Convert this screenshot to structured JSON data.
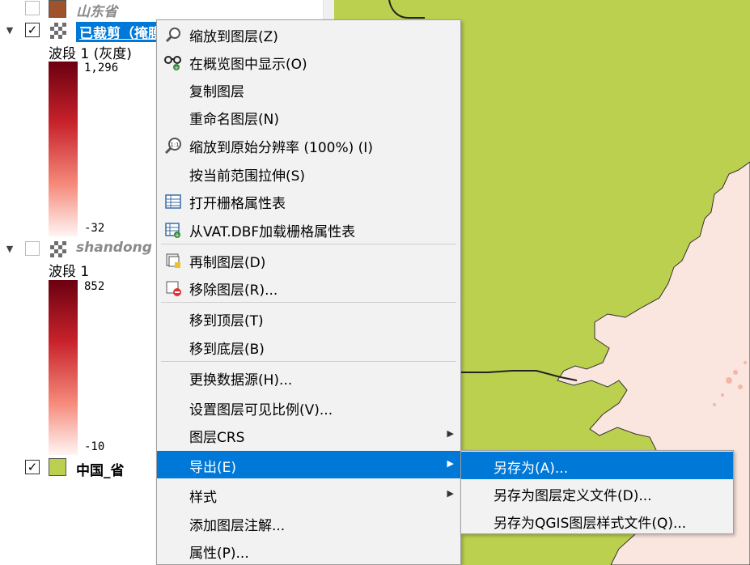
{
  "layers_panel": {
    "layers": [
      {
        "name": "山东省",
        "checked": false,
        "swatch_color": "#a0522d",
        "style": "vector-fill"
      },
      {
        "name": "已裁剪（掩膜",
        "checked": true,
        "selected": true,
        "band_label": "波段 1 (灰度)",
        "max": "1,296",
        "min": "-32"
      },
      {
        "name": "shandong",
        "checked": false,
        "band_label": "波段 1",
        "max": "852",
        "min": "-10"
      },
      {
        "name": "中国_省",
        "checked": true,
        "swatch_color": "#bcd04f"
      }
    ]
  },
  "context_menu": {
    "items": [
      {
        "label": "缩放到图层(Z)",
        "icon": "zoom-to-layer-icon"
      },
      {
        "label": "在概览图中显示(O)",
        "icon": "overview-glasses-icon"
      },
      {
        "label": "复制图层",
        "icon": ""
      },
      {
        "label": "重命名图层(N)",
        "icon": ""
      },
      {
        "label": "缩放到原始分辨率 (100%) (I)",
        "icon": "zoom-native-resolution-icon"
      },
      {
        "label": "按当前范围拉伸(S)",
        "icon": ""
      },
      {
        "label": "打开栅格属性表",
        "icon": "attribute-table-icon"
      },
      {
        "label": "从VAT.DBF加载栅格属性表",
        "icon": "load-attribute-table-icon"
      },
      {
        "label": "再制图层(D)",
        "icon": "duplicate-layer-icon"
      },
      {
        "label": "移除图层(R)...",
        "icon": "remove-layer-icon"
      },
      {
        "label": "移到顶层(T)",
        "icon": ""
      },
      {
        "label": "移到底层(B)",
        "icon": ""
      },
      {
        "label": "更换数据源(H)...",
        "icon": ""
      },
      {
        "label": "设置图层可见比例(V)...",
        "icon": ""
      },
      {
        "label": "图层CRS",
        "icon": "",
        "submenu": true
      },
      {
        "label": "导出(E)",
        "icon": "",
        "submenu": true,
        "highlighted": true
      },
      {
        "label": "样式",
        "icon": "",
        "submenu": true
      },
      {
        "label": "添加图层注解...",
        "icon": ""
      },
      {
        "label": "属性(P)...",
        "icon": ""
      }
    ]
  },
  "export_submenu": {
    "items": [
      {
        "label": "另存为(A)...",
        "highlighted": true
      },
      {
        "label": "另存为图层定义文件(D)..."
      },
      {
        "label": "另存为QGIS图层样式文件(Q)..."
      }
    ]
  },
  "colors": {
    "accent": "#0078d7",
    "map_background": "#bcd04f",
    "map_land": "#fbe6df",
    "ramp_top": "#6b0010",
    "ramp_bottom": "#fff5f3"
  }
}
